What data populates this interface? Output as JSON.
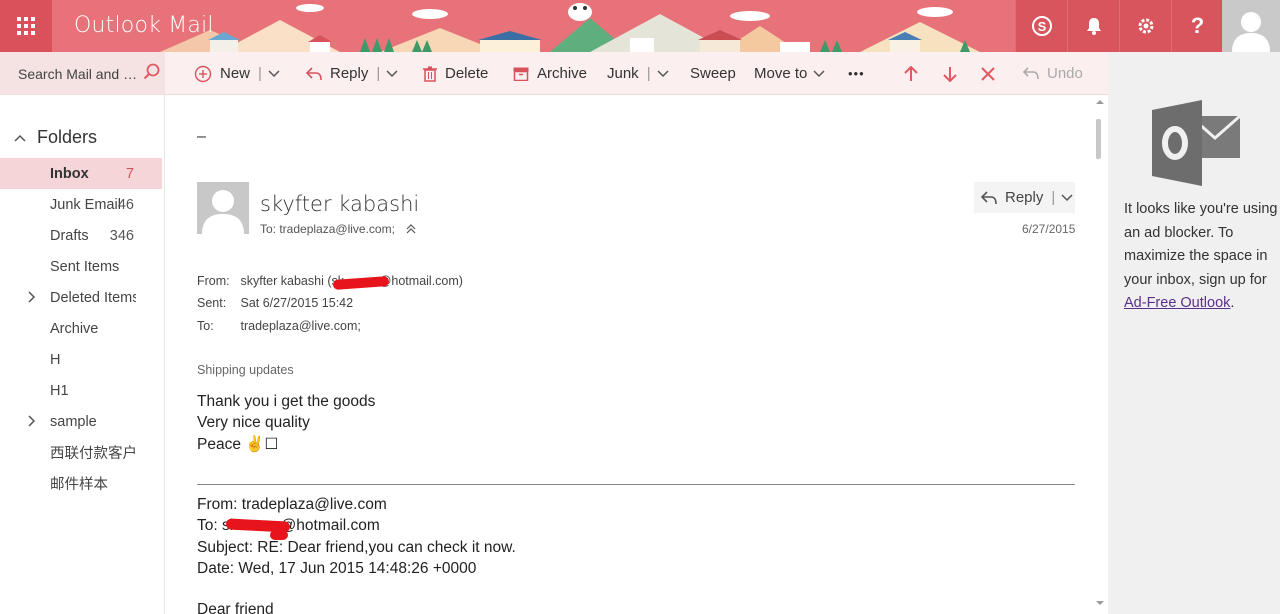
{
  "app": {
    "title": "Outlook Mail"
  },
  "header_icons": [
    {
      "name": "skype-icon",
      "glyph": "S"
    },
    {
      "name": "bell-icon",
      "glyph": ""
    },
    {
      "name": "gear-icon",
      "glyph": ""
    },
    {
      "name": "help-icon",
      "glyph": "?"
    }
  ],
  "search": {
    "placeholder": "Search Mail and P..."
  },
  "toolbar": {
    "new_label": "New",
    "reply_label": "Reply",
    "delete_label": "Delete",
    "archive_label": "Archive",
    "junk_label": "Junk",
    "sweep_label": "Sweep",
    "moveto_label": "Move to",
    "more_label": "•••",
    "undo_label": "Undo"
  },
  "sidebar": {
    "heading": "Folders",
    "items": [
      {
        "label": "Inbox",
        "count": "7",
        "active": true,
        "expandable": false
      },
      {
        "label": "Junk Email",
        "count": "46",
        "active": false,
        "expandable": false
      },
      {
        "label": "Drafts",
        "count": "346",
        "active": false,
        "expandable": false
      },
      {
        "label": "Sent Items",
        "count": "",
        "active": false,
        "expandable": false
      },
      {
        "label": "Deleted Items",
        "count": "",
        "active": false,
        "expandable": true
      },
      {
        "label": "Archive",
        "count": "",
        "active": false,
        "expandable": false
      },
      {
        "label": "H",
        "count": "",
        "active": false,
        "expandable": false
      },
      {
        "label": "H1",
        "count": "",
        "active": false,
        "expandable": false
      },
      {
        "label": "sample",
        "count": "",
        "active": false,
        "expandable": true
      },
      {
        "label": "西联付款客户",
        "count": "",
        "active": false,
        "expandable": false
      },
      {
        "label": "邮件样本",
        "count": "",
        "active": false,
        "expandable": false
      }
    ]
  },
  "message": {
    "collapse": "–",
    "sender_name": "skyfter kabashi",
    "to_line": "To: tradeplaza@live.com;",
    "reply_label": "Reply",
    "date": "6/27/2015",
    "from_label": "From:",
    "from_value": "skyfter kabashi (sk          @hotmail.com)",
    "sent_label": "Sent:",
    "sent_value": "Sat 6/27/2015 15:42",
    "to_label": "To:",
    "to_value": "tradeplaza@live.com;",
    "subject": "Shipping updates",
    "body": [
      "Thank you i get the goods",
      "Very nice quality",
      "Peace ✌☐"
    ],
    "quoted": [
      "From: tradeplaza@live.com",
      "To: sk          @hotmail.com",
      "Subject: RE: Dear friend,you can check it now.",
      "Date: Wed, 17 Jun 2015 14:48:26 +0000"
    ],
    "greeting": "Dear friend"
  },
  "ad": {
    "text": "It looks like you're using an ad blocker. To maximize the space in your inbox, sign up for ",
    "link": "Ad-Free Outlook",
    "tail": "."
  },
  "colors": {
    "header": "#e8727a",
    "accent": "#d9525b",
    "selected": "#f5d5d7",
    "link": "#5b2f8c"
  }
}
